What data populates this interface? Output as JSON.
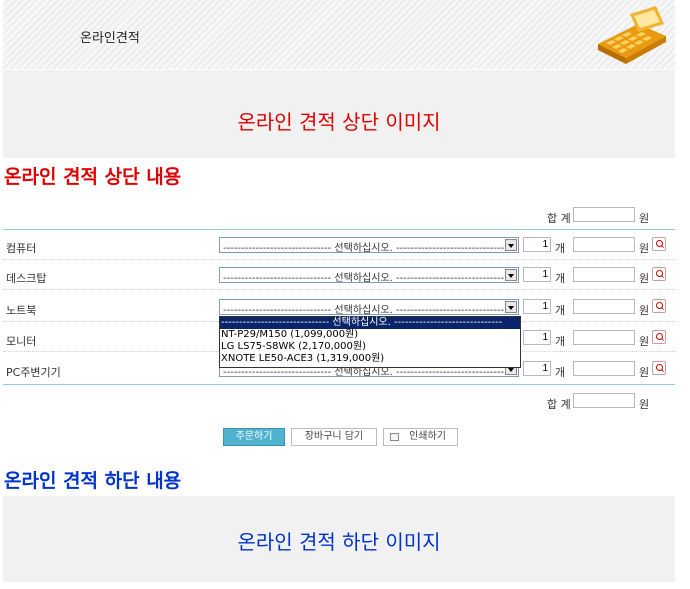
{
  "header": {
    "title": "온라인견적"
  },
  "top_banner": {
    "image_text": "온라인 견적 상단 이미지"
  },
  "top_content": "온라인 견적 상단 내용",
  "total": {
    "label": "합 계",
    "value": "",
    "unit": "원"
  },
  "rows": [
    {
      "label": "컴퓨터",
      "select_value": "------------------------------ 선택하십시오. ------------------------------",
      "qty": "1",
      "qty_unit": "개",
      "price": "",
      "unit": "원"
    },
    {
      "label": "데스크탑",
      "select_value": "------------------------------ 선택하십시오. ------------------------------",
      "qty": "1",
      "qty_unit": "개",
      "price": "",
      "unit": "원"
    },
    {
      "label": "노트북",
      "select_value": "------------------------------ 선택하십시오. ------------------------------",
      "qty": "1",
      "qty_unit": "개",
      "price": "",
      "unit": "원"
    },
    {
      "label": "모니터",
      "select_value": "",
      "qty": "1",
      "qty_unit": "개",
      "price": "",
      "unit": "원"
    },
    {
      "label": "PC주변기기",
      "select_value": "------------------------------ 선택하십시오. ------------------------------",
      "qty": "1",
      "qty_unit": "개",
      "price": "",
      "unit": "원"
    }
  ],
  "dropdown": {
    "options": [
      "------------------------------ 선택하십시오. ------------------------------",
      "NT-P29/M150 (1,099,000원)",
      "LG LS75-S8WK (2,170,000원)",
      "XNOTE LE50-ACE3 (1,319,000원)"
    ]
  },
  "total_bottom": {
    "label": "합 계",
    "value": "",
    "unit": "원"
  },
  "buttons": {
    "order": "주문하기",
    "cart": "장바구니 담기",
    "print": "인쇄하기"
  },
  "bottom_content": "온라인 견적 하단 내용",
  "bottom_banner": {
    "image_text": "온라인 견적 하단 이미지"
  },
  "colors": {
    "accent": "#4fb3cf",
    "red_title": "#e00000",
    "blue_title": "#0033cc"
  }
}
